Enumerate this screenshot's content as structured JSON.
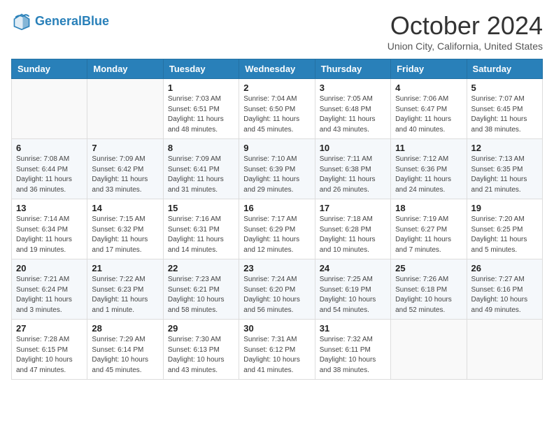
{
  "header": {
    "logo_line1": "General",
    "logo_line2": "Blue",
    "title": "October 2024",
    "location": "Union City, California, United States"
  },
  "days_of_week": [
    "Sunday",
    "Monday",
    "Tuesday",
    "Wednesday",
    "Thursday",
    "Friday",
    "Saturday"
  ],
  "weeks": [
    [
      {
        "day": "",
        "info": ""
      },
      {
        "day": "",
        "info": ""
      },
      {
        "day": "1",
        "info": "Sunrise: 7:03 AM\nSunset: 6:51 PM\nDaylight: 11 hours and 48 minutes."
      },
      {
        "day": "2",
        "info": "Sunrise: 7:04 AM\nSunset: 6:50 PM\nDaylight: 11 hours and 45 minutes."
      },
      {
        "day": "3",
        "info": "Sunrise: 7:05 AM\nSunset: 6:48 PM\nDaylight: 11 hours and 43 minutes."
      },
      {
        "day": "4",
        "info": "Sunrise: 7:06 AM\nSunset: 6:47 PM\nDaylight: 11 hours and 40 minutes."
      },
      {
        "day": "5",
        "info": "Sunrise: 7:07 AM\nSunset: 6:45 PM\nDaylight: 11 hours and 38 minutes."
      }
    ],
    [
      {
        "day": "6",
        "info": "Sunrise: 7:08 AM\nSunset: 6:44 PM\nDaylight: 11 hours and 36 minutes."
      },
      {
        "day": "7",
        "info": "Sunrise: 7:09 AM\nSunset: 6:42 PM\nDaylight: 11 hours and 33 minutes."
      },
      {
        "day": "8",
        "info": "Sunrise: 7:09 AM\nSunset: 6:41 PM\nDaylight: 11 hours and 31 minutes."
      },
      {
        "day": "9",
        "info": "Sunrise: 7:10 AM\nSunset: 6:39 PM\nDaylight: 11 hours and 29 minutes."
      },
      {
        "day": "10",
        "info": "Sunrise: 7:11 AM\nSunset: 6:38 PM\nDaylight: 11 hours and 26 minutes."
      },
      {
        "day": "11",
        "info": "Sunrise: 7:12 AM\nSunset: 6:36 PM\nDaylight: 11 hours and 24 minutes."
      },
      {
        "day": "12",
        "info": "Sunrise: 7:13 AM\nSunset: 6:35 PM\nDaylight: 11 hours and 21 minutes."
      }
    ],
    [
      {
        "day": "13",
        "info": "Sunrise: 7:14 AM\nSunset: 6:34 PM\nDaylight: 11 hours and 19 minutes."
      },
      {
        "day": "14",
        "info": "Sunrise: 7:15 AM\nSunset: 6:32 PM\nDaylight: 11 hours and 17 minutes."
      },
      {
        "day": "15",
        "info": "Sunrise: 7:16 AM\nSunset: 6:31 PM\nDaylight: 11 hours and 14 minutes."
      },
      {
        "day": "16",
        "info": "Sunrise: 7:17 AM\nSunset: 6:29 PM\nDaylight: 11 hours and 12 minutes."
      },
      {
        "day": "17",
        "info": "Sunrise: 7:18 AM\nSunset: 6:28 PM\nDaylight: 11 hours and 10 minutes."
      },
      {
        "day": "18",
        "info": "Sunrise: 7:19 AM\nSunset: 6:27 PM\nDaylight: 11 hours and 7 minutes."
      },
      {
        "day": "19",
        "info": "Sunrise: 7:20 AM\nSunset: 6:25 PM\nDaylight: 11 hours and 5 minutes."
      }
    ],
    [
      {
        "day": "20",
        "info": "Sunrise: 7:21 AM\nSunset: 6:24 PM\nDaylight: 11 hours and 3 minutes."
      },
      {
        "day": "21",
        "info": "Sunrise: 7:22 AM\nSunset: 6:23 PM\nDaylight: 11 hours and 1 minute."
      },
      {
        "day": "22",
        "info": "Sunrise: 7:23 AM\nSunset: 6:21 PM\nDaylight: 10 hours and 58 minutes."
      },
      {
        "day": "23",
        "info": "Sunrise: 7:24 AM\nSunset: 6:20 PM\nDaylight: 10 hours and 56 minutes."
      },
      {
        "day": "24",
        "info": "Sunrise: 7:25 AM\nSunset: 6:19 PM\nDaylight: 10 hours and 54 minutes."
      },
      {
        "day": "25",
        "info": "Sunrise: 7:26 AM\nSunset: 6:18 PM\nDaylight: 10 hours and 52 minutes."
      },
      {
        "day": "26",
        "info": "Sunrise: 7:27 AM\nSunset: 6:16 PM\nDaylight: 10 hours and 49 minutes."
      }
    ],
    [
      {
        "day": "27",
        "info": "Sunrise: 7:28 AM\nSunset: 6:15 PM\nDaylight: 10 hours and 47 minutes."
      },
      {
        "day": "28",
        "info": "Sunrise: 7:29 AM\nSunset: 6:14 PM\nDaylight: 10 hours and 45 minutes."
      },
      {
        "day": "29",
        "info": "Sunrise: 7:30 AM\nSunset: 6:13 PM\nDaylight: 10 hours and 43 minutes."
      },
      {
        "day": "30",
        "info": "Sunrise: 7:31 AM\nSunset: 6:12 PM\nDaylight: 10 hours and 41 minutes."
      },
      {
        "day": "31",
        "info": "Sunrise: 7:32 AM\nSunset: 6:11 PM\nDaylight: 10 hours and 38 minutes."
      },
      {
        "day": "",
        "info": ""
      },
      {
        "day": "",
        "info": ""
      }
    ]
  ]
}
